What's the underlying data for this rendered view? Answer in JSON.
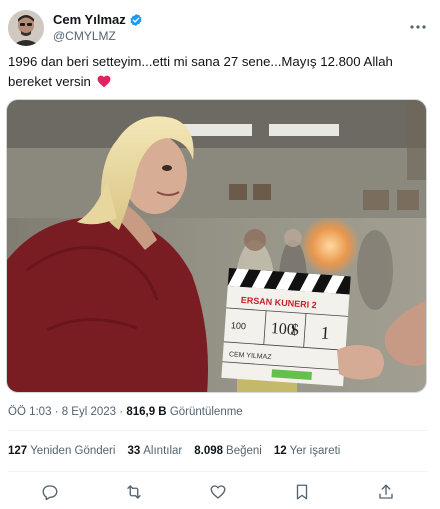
{
  "author": {
    "display_name": "Cem Yılmaz",
    "handle": "@CMYLMZ",
    "verified_icon": "verified-badge-icon",
    "more_icon": "more-dots-icon"
  },
  "tweet": {
    "text": "1996 dan beri setteyim...etti mi  sana 27 sene...Mayış 12.800 Allah bereket versin",
    "emoji": "red-heart-icon"
  },
  "media": {
    "clapper_title": "ERSAN KUNERI 2",
    "clapper_row1": [
      "100",
      "100",
      "$",
      "1"
    ],
    "clapper_director": "CEM YILMAZ"
  },
  "meta": {
    "time": "ÖÖ 1:03",
    "separator": "·",
    "date": "8 Eyl 2023",
    "views_count": "816,9 B",
    "views_label": "Görüntülenme"
  },
  "stats": [
    {
      "count": "127",
      "label": "Yeniden Gönderi"
    },
    {
      "count": "33",
      "label": "Alıntılar"
    },
    {
      "count": "8.098",
      "label": "Beğeni"
    },
    {
      "count": "12",
      "label": "Yer işareti"
    }
  ],
  "actions": [
    "reply-icon",
    "repost-icon",
    "like-icon",
    "bookmark-icon",
    "share-icon"
  ],
  "colors": {
    "verified": "#1d9bf0",
    "heart": "#e0245e",
    "secondary_text": "#536471",
    "divider": "#eff3f4"
  }
}
